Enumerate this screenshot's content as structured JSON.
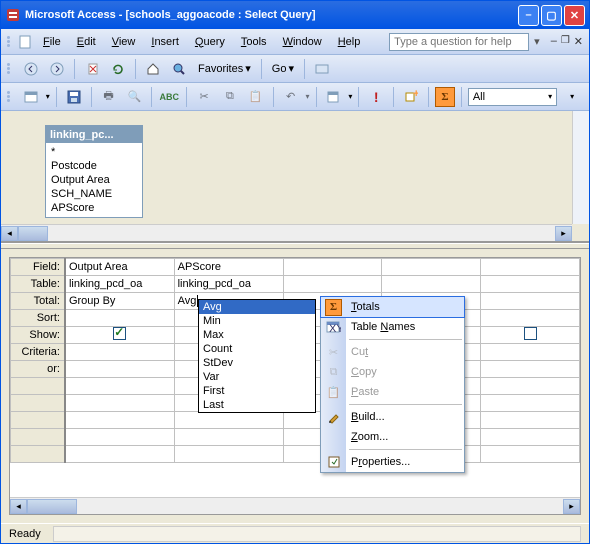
{
  "title": "Microsoft Access - [schools_aggoacode : Select Query]",
  "menus": {
    "file": "File",
    "edit": "Edit",
    "view": "View",
    "insert": "Insert",
    "query": "Query",
    "tools": "Tools",
    "window": "Window",
    "help": "Help"
  },
  "help_placeholder": "Type a question for help",
  "tb2": {
    "go": "Go",
    "fav": "Favorites"
  },
  "tb3": {
    "combo": "All"
  },
  "table_panel": {
    "title": "linking_pc...",
    "fields": [
      "*",
      "Postcode",
      "Output Area",
      "SCH_NAME",
      "APScore"
    ]
  },
  "rows": {
    "field": "Field:",
    "table": "Table:",
    "total": "Total:",
    "sort": "Sort:",
    "show": "Show:",
    "criteria": "Criteria:",
    "or": "or:"
  },
  "cells": {
    "col1": {
      "field": "Output Area",
      "table": "linking_pcd_oa",
      "total": "Group By"
    },
    "col2": {
      "field": "APScore",
      "table": "linking_pcd_oa",
      "total": "Avg"
    }
  },
  "dropdown_options": [
    "Avg",
    "Min",
    "Max",
    "Count",
    "StDev",
    "Var",
    "First",
    "Last"
  ],
  "dropdown_selected": "Avg",
  "ctx": {
    "totals": "Totals",
    "tablenames": "Table Names",
    "cut": "Cut",
    "copy": "Copy",
    "paste": "Paste",
    "build": "Build...",
    "zoom": "Zoom...",
    "properties": "Properties..."
  },
  "status": "Ready"
}
